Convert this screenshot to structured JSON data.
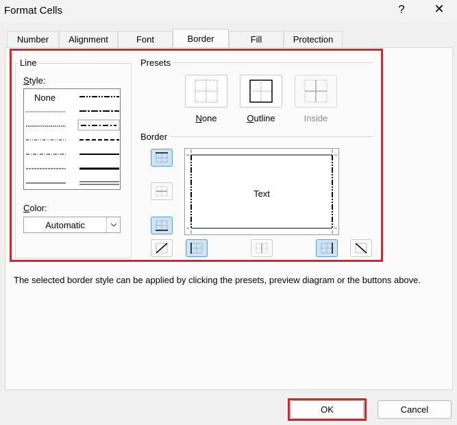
{
  "window": {
    "title": "Format Cells",
    "help": "?",
    "close": "✕"
  },
  "tabs": [
    "Number",
    "Alignment",
    "Font",
    "Border",
    "Fill",
    "Protection"
  ],
  "line": {
    "group_label": "Line",
    "style_label_pre": "",
    "style_label_u": "S",
    "style_label_post": "tyle:",
    "none_label": "None",
    "color_label_pre": "",
    "color_label_u": "C",
    "color_label_post": "olor:",
    "color_value": "Automatic"
  },
  "presets": {
    "group_label": "Presets",
    "none": {
      "u": "N",
      "rest": "one"
    },
    "outline": {
      "u": "O",
      "rest": "utline"
    },
    "inside": "Inside"
  },
  "border": {
    "group_label": "Border",
    "preview_text": "Text"
  },
  "hint": "The selected border style can be applied by clicking the presets, preview diagram or the buttons above.",
  "buttons": {
    "ok": "OK",
    "cancel": "Cancel"
  },
  "colors": {
    "highlight_red": "#e0202a",
    "selected_blue": "#cce4f7"
  }
}
